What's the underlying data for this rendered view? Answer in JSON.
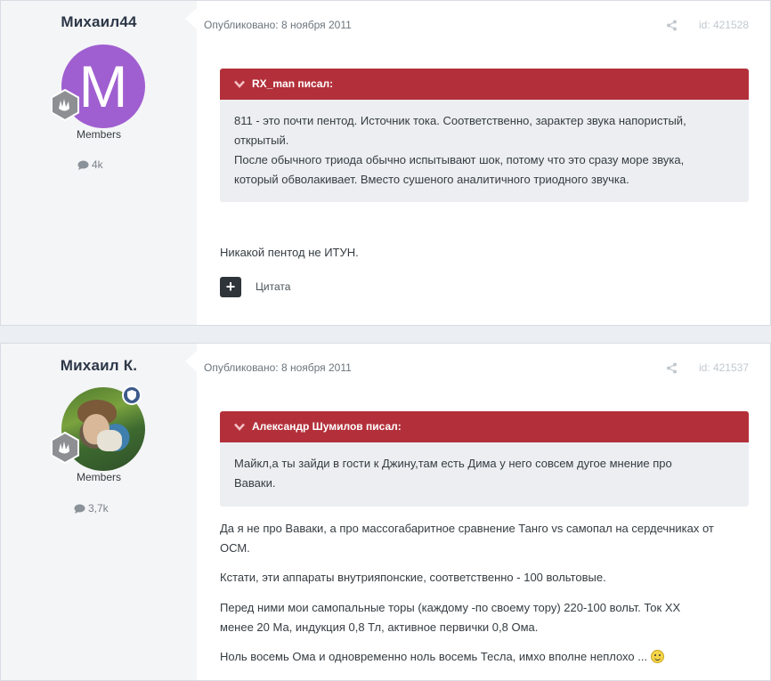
{
  "posts": [
    {
      "author": "Михаил44",
      "avatar_letter": "M",
      "avatar_color": "#a05fd0",
      "group": "Members",
      "post_count": "4k",
      "published": "Опубликовано: 8 ноября 2011",
      "post_id": "id: 421528",
      "quote_author": "RX_man писал:",
      "quote_lines": [
        "811 - это почти пентод. Источник тока. Соответственно, зарактер звука напористый,",
        "открытый.",
        "После обычного триода обычно испытывают шок, потому что это сразу море звука,",
        "который обволакивает. Вместо сушеного аналитичного триодного звучка."
      ],
      "body": [
        "Никакой пентод не ИТУН."
      ],
      "quote_button": "Цитата"
    },
    {
      "author": "Михаил К.",
      "group": "Members",
      "post_count": "3,7k",
      "published": "Опубликовано: 8 ноября 2011",
      "post_id": "id: 421537",
      "quote_author": "Александр Шумилов писал:",
      "quote_lines": [
        "Майкл,а ты зайди в гости к Джину,там есть Дима у него совсем дугое мнение про",
        "Ваваки."
      ],
      "body": [
        "Да я не про Ваваки, а про массогабаритное сравнение Танго vs самопал на сердечниках от",
        "ОСМ.",
        "Кстати, эти аппараты внутрияпонские, соответственно - 100 вольтовые.",
        "Перед ними мои самопальные торы (каждому -по своему тору) 220-100 вольт. Ток ХХ",
        "менее 20 Ма, индукция 0,8 Тл, активное первички 0,8 Ома.",
        "Ноль восемь Ома и одновременно ноль восемь Тесла, имхо вполне неплохо ..."
      ]
    }
  ],
  "colors": {
    "quote_header": "#b3303a",
    "quote_bg": "#eceef2",
    "author_panel": "#f4f5f7"
  }
}
